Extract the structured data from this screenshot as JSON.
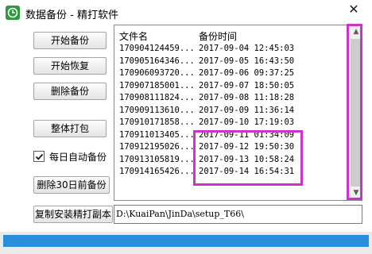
{
  "window": {
    "title": "数据备份 - 精打软件",
    "close_glyph": "✕"
  },
  "buttons": {
    "start_backup": "开始备份",
    "start_restore": "开始恢复",
    "delete_backup": "删除备份",
    "pack_all": "整体打包",
    "delete_30days": "删除30日前备份",
    "copy_install": "复制安装精打副本"
  },
  "auto_backup": {
    "label": "每日自动备份",
    "checked": true
  },
  "list": {
    "headers": {
      "filename": "文件名",
      "time": "备份时间"
    },
    "rows": [
      {
        "name": "170904124459...",
        "time": "2017-09-04 12:45:03"
      },
      {
        "name": "170905164346...",
        "time": "2017-09-05 16:43:50"
      },
      {
        "name": "170906093720...",
        "time": "2017-09-06 09:37:25"
      },
      {
        "name": "170907185001...",
        "time": "2017-09-07 18:50:05"
      },
      {
        "name": "170908111824...",
        "time": "2017-09-08 11:18:28"
      },
      {
        "name": "170909113610...",
        "time": "2017-09-09 11:36:14"
      },
      {
        "name": "170910171858...",
        "time": "2017-09-10 17:19:03"
      },
      {
        "name": "170911013405...",
        "time": "2017-09-11 01:34:09"
      },
      {
        "name": "170912195026...",
        "time": "2017-09-12 19:50:30"
      },
      {
        "name": "170913105819...",
        "time": "2017-09-13 10:58:24"
      },
      {
        "name": "170914165426...",
        "time": "2017-09-14 16:54:31"
      }
    ]
  },
  "path": {
    "value": "D:\\KuaiPan\\JinDa\\setup_T66\\"
  },
  "colors": {
    "highlight": "#cc33cc",
    "accent": "#2a8fd8",
    "icon": "#2e9a3e"
  }
}
